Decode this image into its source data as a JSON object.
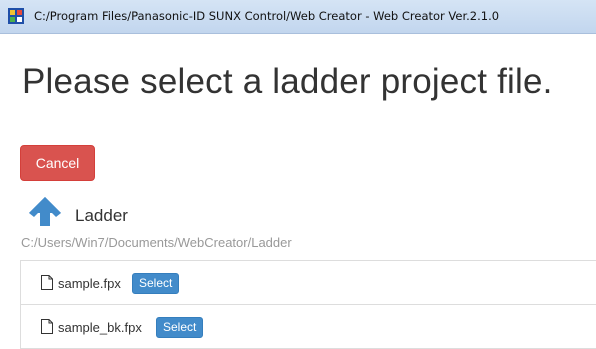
{
  "window": {
    "title": "C:/Program Files/Panasonic-ID SUNX Control/Web Creator - Web Creator Ver.2.1.0",
    "icon": "web-creator-app-icon"
  },
  "page": {
    "heading": "Please select a ladder project file."
  },
  "actions": {
    "cancel_label": "Cancel",
    "cancel_color": "#d9534f"
  },
  "folder": {
    "up_icon": "arrow-up-icon",
    "name": "Ladder",
    "path": "C:/Users/Win7/Documents/WebCreator/Ladder"
  },
  "files": [
    {
      "name": "sample.fpx",
      "select_label": "Select",
      "icon": "file-icon"
    },
    {
      "name": "sample_bk.fpx",
      "select_label": "Select",
      "icon": "file-icon"
    }
  ],
  "colors": {
    "select_button": "#428bca",
    "up_arrow": "#428bca"
  }
}
